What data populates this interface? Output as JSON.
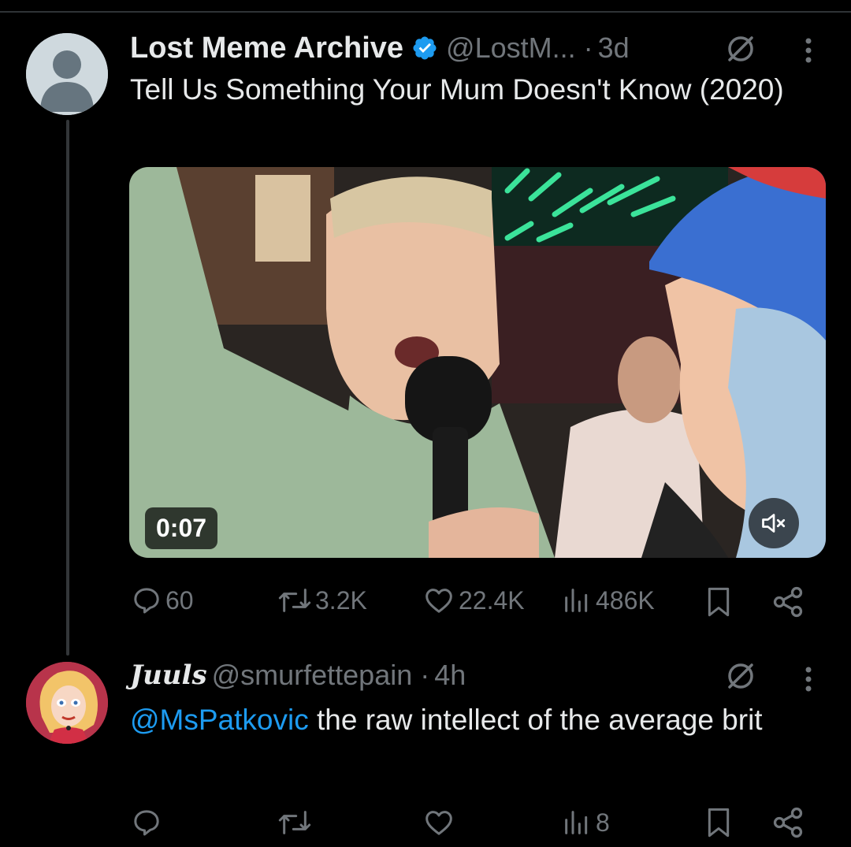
{
  "post": {
    "author_name": "Lost Meme Archive",
    "handle": "@LostM...",
    "separator": "·",
    "time": "3d",
    "text": "Tell Us Something Your Mum Doesn't Know (2020)",
    "video_duration": "0:07",
    "stats": {
      "replies": "60",
      "reposts": "3.2K",
      "likes": "22.4K",
      "views": "486K"
    }
  },
  "reply": {
    "author_name": "Juuls",
    "handle": "@smurfettepain",
    "separator": "·",
    "time": "4h",
    "mention": "@MsPatkovic",
    "text": " the raw intellect of the average brit",
    "stats": {
      "views": "8"
    }
  },
  "colors": {
    "background": "#000000",
    "text_primary": "#e7e9ea",
    "text_secondary": "#71767b",
    "accent": "#1d9bf0",
    "divider": "#2f3336"
  },
  "icons": [
    "verified-badge-icon",
    "grok-icon",
    "more-icon",
    "reply-icon",
    "repost-icon",
    "like-icon",
    "views-icon",
    "bookmark-icon",
    "share-icon",
    "mute-icon"
  ]
}
